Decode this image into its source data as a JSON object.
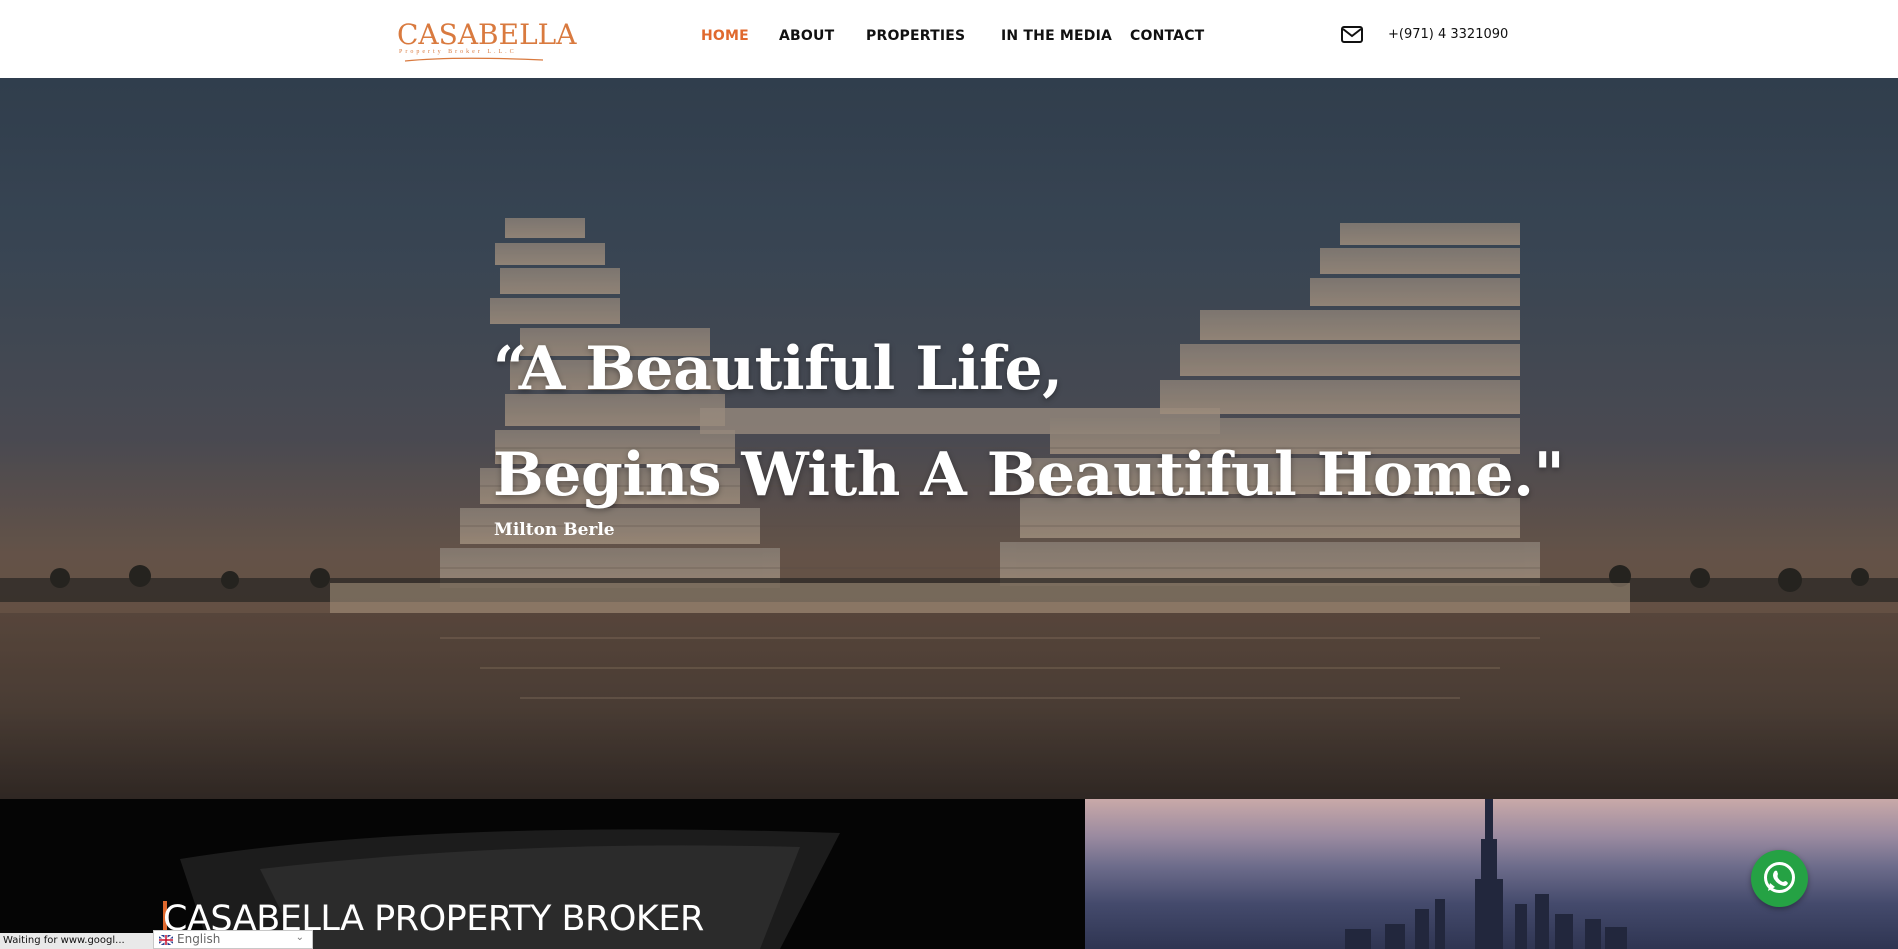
{
  "header": {
    "logo": {
      "name": "CASABELLA",
      "tagline": "Property Broker L.L.C"
    },
    "nav": [
      {
        "label": "HOME",
        "active": true
      },
      {
        "label": "ABOUT",
        "active": false
      },
      {
        "label": "PROPERTIES",
        "active": false
      },
      {
        "label": "IN THE MEDIA",
        "active": false
      },
      {
        "label": "CONTACT",
        "active": false
      }
    ],
    "email_icon": "envelope-icon",
    "phone": "+(971) 4 3321090"
  },
  "hero": {
    "quote_line1": "“A Beautiful Life,",
    "quote_line2": "Begins With A Beautiful Home.\"",
    "author": "Milton Berle"
  },
  "about": {
    "title": "CASABELLA PROPERTY BROKER"
  },
  "floating": {
    "whatsapp_icon": "whatsapp-icon"
  },
  "browser_status": "Waiting for www.googl...",
  "language_selector": {
    "value": "English",
    "flag_icon": "uk-flag-icon"
  },
  "colors": {
    "accent": "#e0692e",
    "logo": "#d97a3f",
    "whatsapp": "#25a244"
  }
}
